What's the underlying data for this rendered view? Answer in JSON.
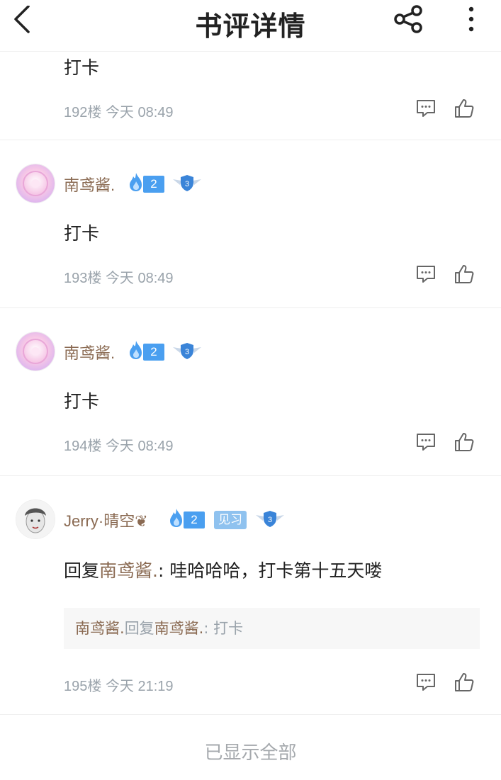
{
  "header": {
    "title": "书评详情"
  },
  "comments": [
    {
      "content": "打卡",
      "floor": "192楼",
      "time": "今天 08:49"
    },
    {
      "user": "南鸢酱.",
      "fire_level": "2",
      "shield_level": "3",
      "content": "打卡",
      "floor": "193楼",
      "time": "今天 08:49"
    },
    {
      "user": "南鸢酱.",
      "fire_level": "2",
      "shield_level": "3",
      "content": "打卡",
      "floor": "194楼",
      "time": "今天 08:49"
    },
    {
      "user": "Jerry·晴空❦",
      "fire_level": "2",
      "rank": "见习",
      "shield_level": "3",
      "reply_prefix": "回复",
      "reply_to": "南鸢酱.",
      "reply_sep": ": ",
      "reply_text": "哇哈哈哈，打卡第十五天喽",
      "quote": {
        "author": "南鸢酱.",
        "mid": "回复",
        "target": "南鸢酱.",
        "sep": ": ",
        "text": "打卡"
      },
      "floor": "195楼",
      "time": "今天 21:19"
    }
  ],
  "footer": {
    "label": "已显示全部"
  },
  "icons": [
    "back-icon",
    "share-icon",
    "more-icon",
    "comment-icon",
    "like-icon",
    "fire-icon",
    "shield-icon"
  ],
  "colors": {
    "username": "#8a6a52",
    "meta": "#9aa3ab",
    "badge_blue": "#4a9ff0"
  }
}
